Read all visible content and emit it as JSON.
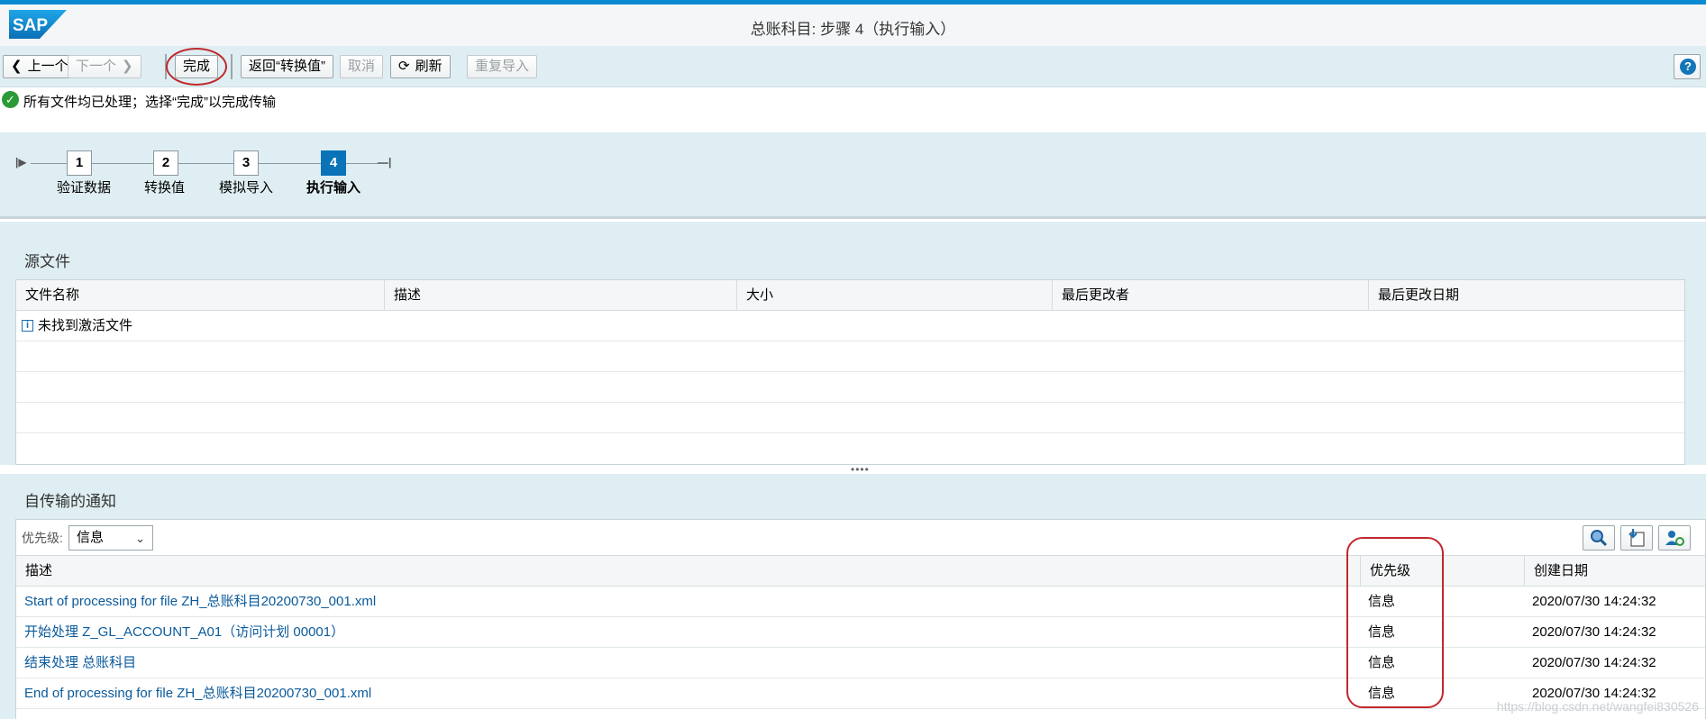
{
  "app": {
    "logo_text": "SAP",
    "window_title": "总账科目: 步骤 4（执行输入）"
  },
  "toolbar": {
    "prev_label": "上一个",
    "next_label": "下一个",
    "finish_label": "完成",
    "back_label": "返回“转换值”",
    "cancel_label": "取消",
    "refresh_label": "刷新",
    "reimport_label": "重复导入",
    "help_label": "?"
  },
  "message": {
    "text": "所有文件均已处理；选择“完成”以完成传输"
  },
  "steps": [
    {
      "number": "1",
      "label": "验证数据",
      "active": false
    },
    {
      "number": "2",
      "label": "转换值",
      "active": false
    },
    {
      "number": "3",
      "label": "模拟导入",
      "active": false
    },
    {
      "number": "4",
      "label": "执行输入",
      "active": true
    }
  ],
  "source_files": {
    "title": "源文件",
    "columns": [
      "文件名称",
      "描述",
      "大小",
      "最后更改者",
      "最后更改日期"
    ],
    "empty_text": "未找到激活文件"
  },
  "notifications": {
    "title": "自传输的通知",
    "filter_label": "优先级:",
    "filter_value": "信息",
    "columns": [
      "描述",
      "优先级",
      "创建日期"
    ],
    "rows": [
      {
        "description": "Start of processing for file ZH_总账科目20200730_001.xml",
        "priority": "信息",
        "created": "2020/07/30 14:24:32"
      },
      {
        "description": "开始处理 Z_GL_ACCOUNT_A01（访问计划 00001）",
        "priority": "信息",
        "created": "2020/07/30 14:24:32"
      },
      {
        "description": "结束处理 总账科目",
        "priority": "信息",
        "created": "2020/07/30 14:24:32"
      },
      {
        "description": "End of processing for file ZH_总账科目20200730_001.xml",
        "priority": "信息",
        "created": "2020/07/30 14:24:32"
      }
    ]
  },
  "watermark": "https://blog.csdn.net/wangfei830526",
  "colors": {
    "accent": "#0a8ad2",
    "link": "#0a5a9b",
    "active_step": "#0a73b8",
    "annotation": "#c0282d",
    "success": "#2c9a37"
  }
}
